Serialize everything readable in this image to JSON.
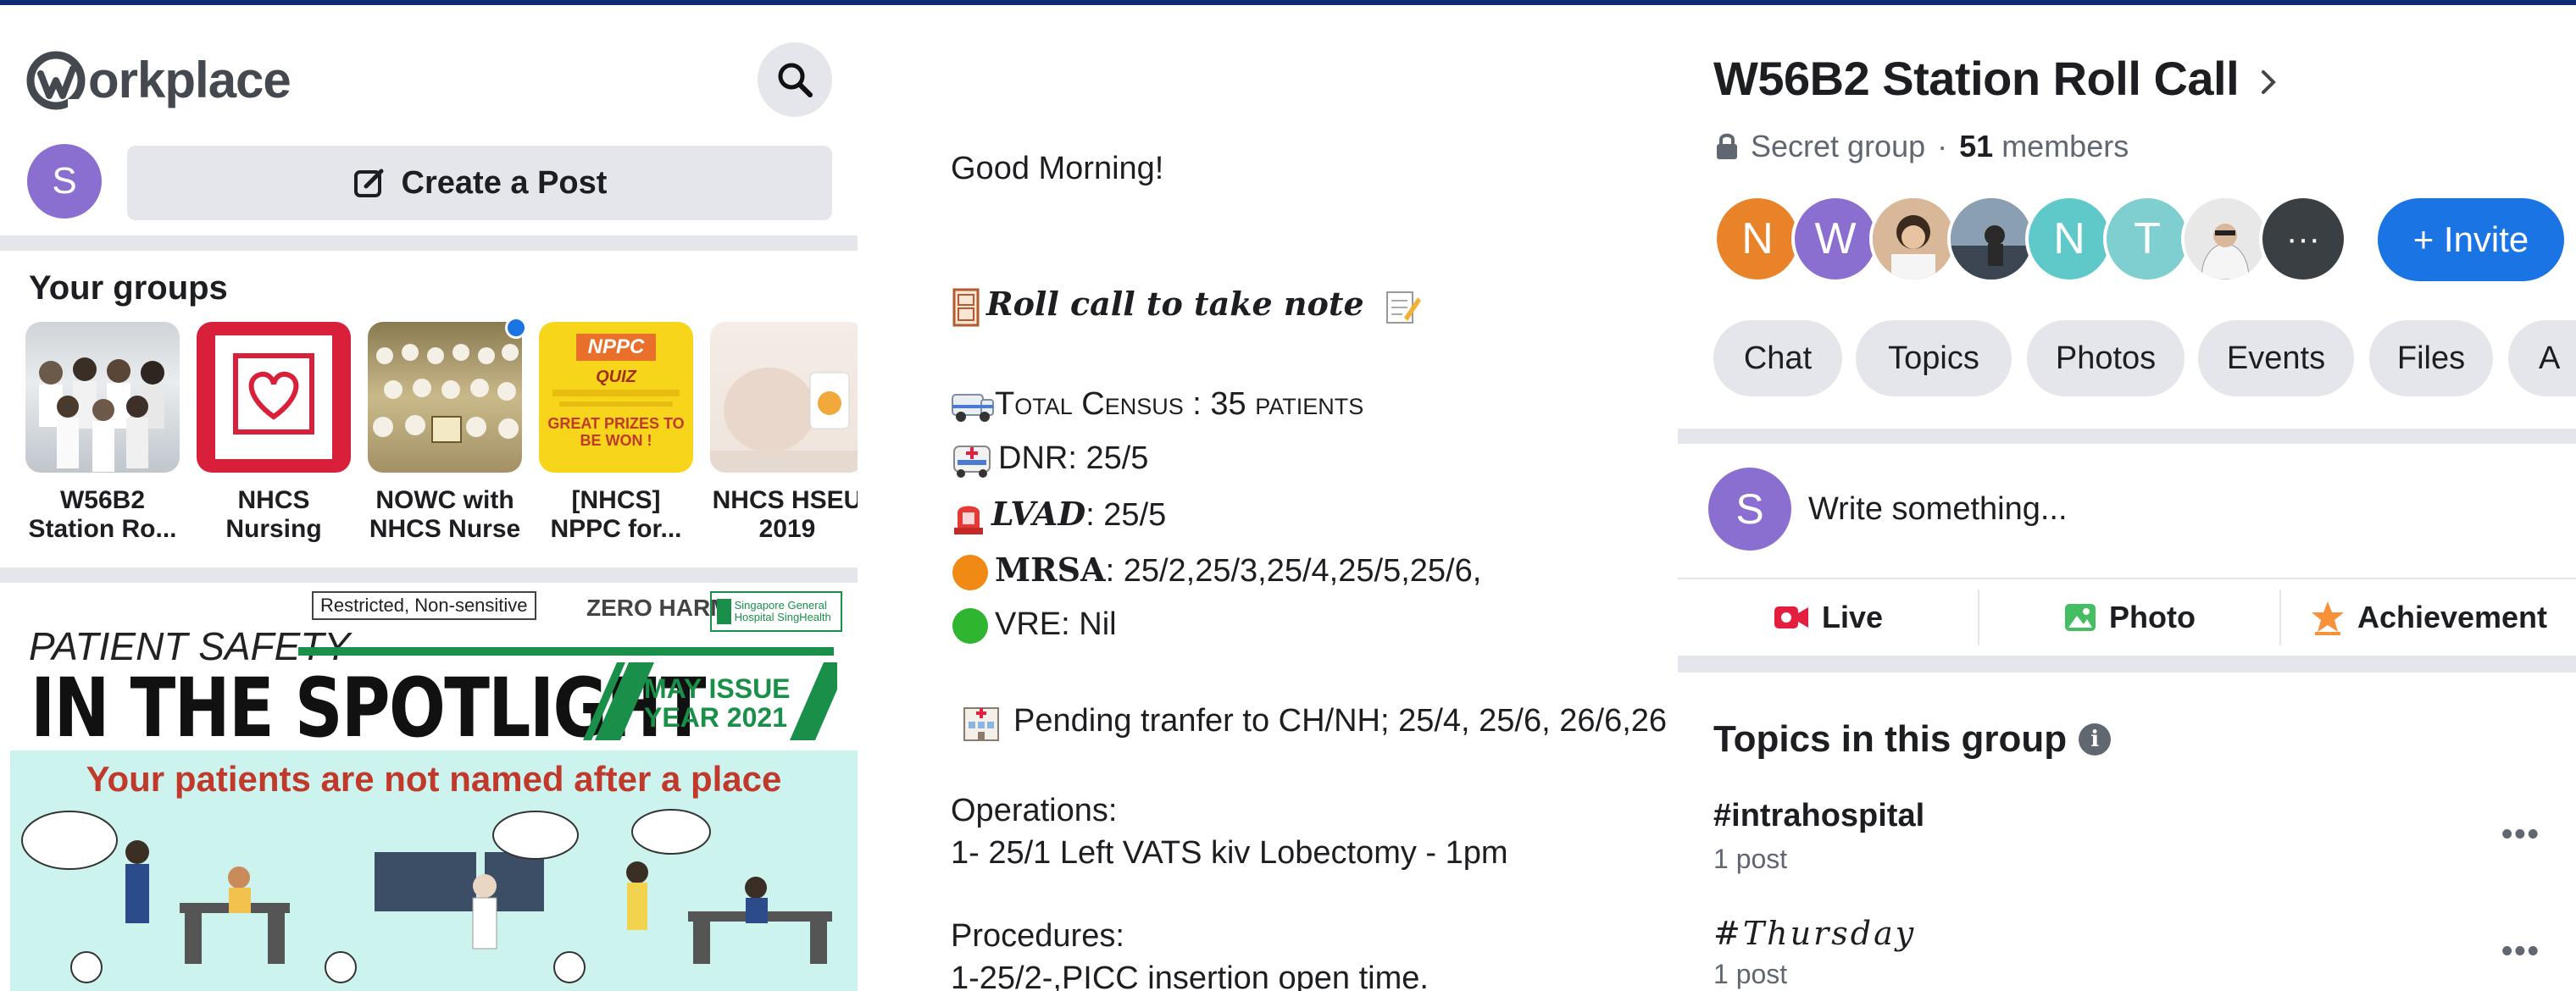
{
  "left": {
    "app_name": "orkplace",
    "avatar_initial": "S",
    "create_post_label": "Create a Post",
    "groups_title": "Your groups",
    "groups": [
      {
        "line1": "W56B2",
        "line2": "Station Ro..."
      },
      {
        "line1": "NHCS",
        "line2": "Nursing"
      },
      {
        "line1": "NOWC with",
        "line2": "NHCS Nurse"
      },
      {
        "line1": "[NHCS]",
        "line2": "NPPC for..."
      },
      {
        "line1": "NHCS HSEU",
        "line2": "2019"
      }
    ],
    "poster": {
      "restricted": "Restricted, Non-sensitive",
      "zero_harm": "ZERO HARM",
      "hospital": "Singapore General Hospital SingHealth",
      "kicker": "PATIENT SAFETY",
      "headline": "IN THE SPOTLIGHT",
      "issue_line1": "MAY ISSUE",
      "issue_line2": "YEAR 2021",
      "banner_title": "Your patients are not named after a place"
    },
    "nppc_thumb": {
      "title": "NPPC",
      "sub": "QUIZ",
      "prize": "GREAT PRIZES TO BE WON !"
    }
  },
  "middle": {
    "greeting": "Good Morning!",
    "roll_call": "Roll call to take note",
    "census": "Total Census  : 35 patients",
    "dnr": "DNR: 25/5",
    "lvad_label": "LVAD",
    "lvad_value": ": 25/5",
    "mrsa_label": "MRSA",
    "mrsa_value": ": 25/2,25/3,25/4,25/5,25/6,",
    "vre": "VRE: Nil",
    "pending": "Pending tranfer to CH/NH; 25/4, 25/6, 26/6,26",
    "operations_title": "Operations:",
    "operations_item": "1- 25/1 Left VATS kiv Lobectomy - 1pm",
    "procedures_title": "Procedures:",
    "procedures_item": "1-25/2-,PICC insertion open time."
  },
  "right": {
    "group_title": "W56B2 Station Roll Call",
    "privacy": "Secret group",
    "dot": "·",
    "member_count": "51",
    "members_label": "members",
    "member_initials": [
      "N",
      "W",
      "",
      "",
      "N",
      "T",
      "",
      "···"
    ],
    "member_colors": [
      "#e8832a",
      "#8b6fd0",
      "#b07a5a",
      "#4b5a6a",
      "#5fc9c9",
      "#7fcfd0",
      "#c8c8c8",
      "#3a3f44"
    ],
    "invite_label": "+ Invite",
    "tabs": [
      "Chat",
      "Topics",
      "Photos",
      "Events",
      "Files",
      "A"
    ],
    "composer_initial": "S",
    "composer_placeholder": "Write something...",
    "actions": [
      "Live",
      "Photo",
      "Achievement"
    ],
    "topics_title": "Topics in this group",
    "topics": [
      {
        "name": "#intrahospital",
        "count": "1 post"
      },
      {
        "name": "#Thursday",
        "count": "1 post"
      }
    ]
  },
  "colors": {
    "accent": "#1b74e4",
    "avatar_purple": "#8b6fd0",
    "panel_gray": "#e4e6eb",
    "secondary_text": "#606770",
    "live_red": "#e41e3f",
    "photo_green": "#45bd62",
    "achievement_orange": "#f7923b"
  }
}
